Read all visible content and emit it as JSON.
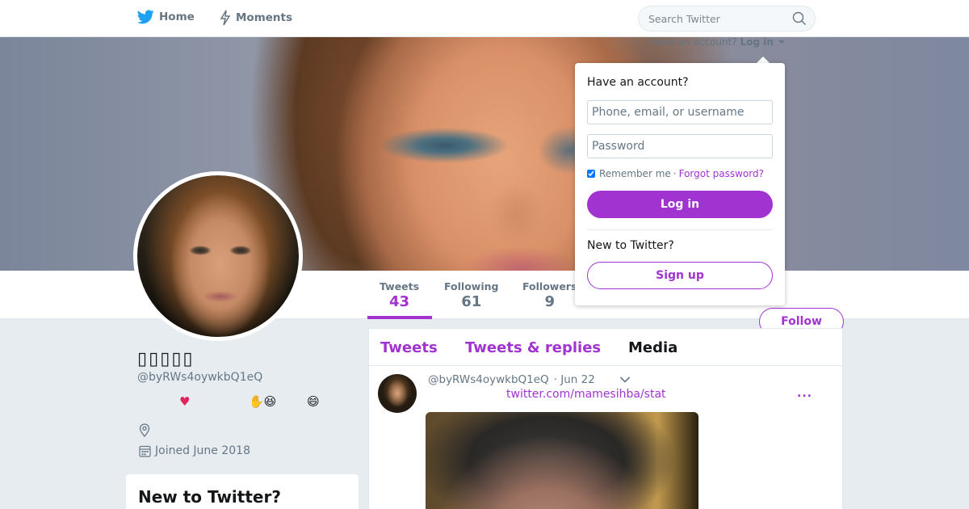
{
  "nav": {
    "home_label": "Home",
    "moments_label": "Moments",
    "search_placeholder": "Search Twitter",
    "home_icon": "twitter-bird-icon",
    "moments_icon": "lightning-icon",
    "search_icon": "magnifier-icon"
  },
  "login_hint": {
    "text": "Have an account?",
    "link": "Log in"
  },
  "dropdown": {
    "title": "Have an account?",
    "username_placeholder": "Phone, email, or username",
    "password_placeholder": "Password",
    "remember_label": "Remember me",
    "separator": "·",
    "forgot_label": "Forgot password?",
    "login_button": "Log in",
    "new_label": "New to Twitter?",
    "signup_button": "Sign up"
  },
  "profile": {
    "name": "▯▯▯▯▯",
    "handle": "@byRWs4oywkbQ1eQ",
    "bio_emojis": [
      "♥",
      "✋😆",
      "😄"
    ],
    "joined": "Joined June 2018",
    "follow_button": "Follow"
  },
  "stats": [
    {
      "label": "Tweets",
      "value": "43"
    },
    {
      "label": "Following",
      "value": "61"
    },
    {
      "label": "Followers",
      "value": "9"
    }
  ],
  "sidebar_card": {
    "title": "New to Twitter?"
  },
  "timeline": {
    "tabs": [
      "Tweets",
      "Tweets & replies",
      "Media"
    ],
    "tweet": {
      "handle": "@byRWs4oywkbQ1eQ",
      "date": "· Jun 22",
      "link": "twitter.com/mamesihba/stat",
      "more": "..."
    }
  },
  "colors": {
    "accent": "#a133d1",
    "text_primary": "#14171a",
    "text_secondary": "#657786",
    "background": "#e6ecf0"
  }
}
